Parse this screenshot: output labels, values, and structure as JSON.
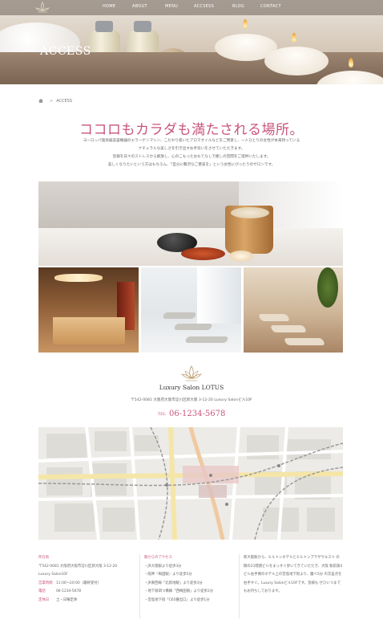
{
  "nav": {
    "items": [
      "HOME",
      "ABOUT",
      "MENU",
      "ACCSESS",
      "BLOG",
      "CONTACT"
    ]
  },
  "hero": {
    "title": "ACCESS"
  },
  "breadcrumb": {
    "current": "ACCESS"
  },
  "headline": "ココロもカラダも満たされる場所。",
  "intro": [
    "ヨーロッパ発高級美容機器のエラーゲンマシン、こだわり抜いたアロマオイルなどをご用意し、一人ひとりの女性が本来持っている",
    "ナチュラルな美しさを引き出すお手伝いをさせていただきます。",
    "皆様を日々のストレスから解放し、心のこもったおもてなしで癒しの空間をご提供いたします。",
    "美しくなりたいという方はもちろん、「自分に贅沢なご褒美を」という女性にぴったりのサロンです。"
  ],
  "salon": {
    "name": "Luxury Salon LOTUS",
    "address": "〒542-0081 大阪府大阪市淀川区新大阪 3-12-20 Luxury Salonビル10F",
    "tel_label": "TEL",
    "tel": "06-1234-5678"
  },
  "info": {
    "col1": [
      {
        "label": "所在地",
        "value": ""
      },
      {
        "label": "",
        "value": "〒542-0081 大阪府大阪市淀川区新大阪 3-12-20"
      },
      {
        "label": "",
        "value": "Luxury Salon10F"
      },
      {
        "label": "営業時間",
        "value": "11:00～20:00（最終受付）"
      },
      {
        "label": "電話",
        "value": "06-1234-5678"
      },
      {
        "label": "定休日",
        "value": "土・日曜定休"
      }
    ],
    "col2_head": "駅からのアクセス",
    "col2": [
      "・JR大阪駅より徒歩3分",
      "・阪神『梅田駅』より徒歩5分",
      "・JR東西線「北新地駅」より徒歩3分",
      "・地下鉄四つ橋線「西梅田駅」より徒歩2分",
      "・堂島地下街「C65番出口」より徒歩1分"
    ],
    "col3": "新大阪駅から、ヒルトンホテルとヒルトンプラザウエスト の間の21階建ビルをまっすぐ歩いてきていただき、大阪 駅前第4ビル右手側のホテル上の堂島地下街より、腹べ5分 の交差点を右手すぐ。Luxury Salonビル10Fです。皆様も ぜひいつまでもお待ちしております。"
  },
  "colors": {
    "accent": "#c9557b",
    "nav_bg": "#6e6056",
    "text": "#666666"
  }
}
